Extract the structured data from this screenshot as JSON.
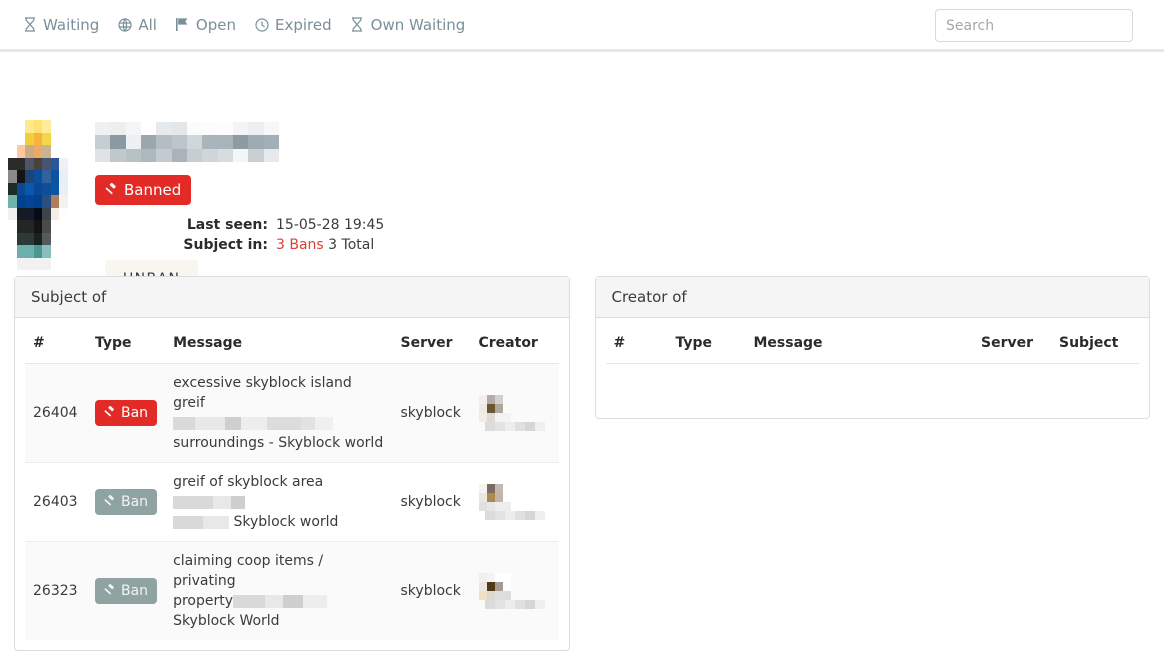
{
  "nav": {
    "items": [
      {
        "label": "Waiting",
        "icon": "hourglass-icon"
      },
      {
        "label": "All",
        "icon": "globe-icon"
      },
      {
        "label": "Open",
        "icon": "flag-icon"
      },
      {
        "label": "Expired",
        "icon": "clock-icon"
      },
      {
        "label": "Own Waiting",
        "icon": "hourglass-icon"
      }
    ]
  },
  "search": {
    "placeholder": "Search",
    "value": ""
  },
  "profile": {
    "username_redacted": true,
    "status_badge": {
      "label": "Banned",
      "icon": "gavel-icon",
      "color": "#e22b26"
    },
    "details": [
      {
        "label": "Last seen:",
        "value": "15-05-28 19:45"
      }
    ],
    "subject_in_label": "Subject in:",
    "subject_in_bans": "3 Bans",
    "subject_in_total": "3 Total",
    "action_button": "UNBAN"
  },
  "panels": {
    "subject_of": {
      "title": "Subject of",
      "columns": [
        "#",
        "Type",
        "Message",
        "Server",
        "Creator"
      ],
      "rows": [
        {
          "id": "26404",
          "type": {
            "label": "Ban",
            "icon": "gavel-icon",
            "state": "active",
            "color": "#e22b26"
          },
          "message_line1": "excessive skyblock island greif",
          "message_redacted": true,
          "message_line3": "surroundings - Skyblock world",
          "server": "skyblock",
          "creator_redacted": true
        },
        {
          "id": "26403",
          "type": {
            "label": "Ban",
            "icon": "gavel-icon",
            "state": "inactive",
            "color": "#8fa3a3"
          },
          "message_line1": "greif of skyblock area",
          "message_redacted": true,
          "message_line3": "Skyblock world",
          "server": "skyblock",
          "creator_redacted": true
        },
        {
          "id": "26323",
          "type": {
            "label": "Ban",
            "icon": "gavel-icon",
            "state": "inactive",
            "color": "#8fa3a3"
          },
          "message_line1": "claiming coop items / privating",
          "message_line2": "property",
          "message_redacted": true,
          "message_line3": "Skyblock World",
          "server": "skyblock",
          "creator_redacted": true
        }
      ]
    },
    "creator_of": {
      "title": "Creator of",
      "columns": [
        "#",
        "Type",
        "Message",
        "Server",
        "Subject"
      ],
      "rows": []
    }
  },
  "colors": {
    "nav_text": "#7a8f99",
    "divider": "#e2e9ea",
    "ban_active": "#e22b26",
    "ban_inactive": "#8fa3a3",
    "bans_link": "#d9413b",
    "panel_header_bg": "#f5f5f5",
    "unban_bg": "#f8f6f1"
  }
}
